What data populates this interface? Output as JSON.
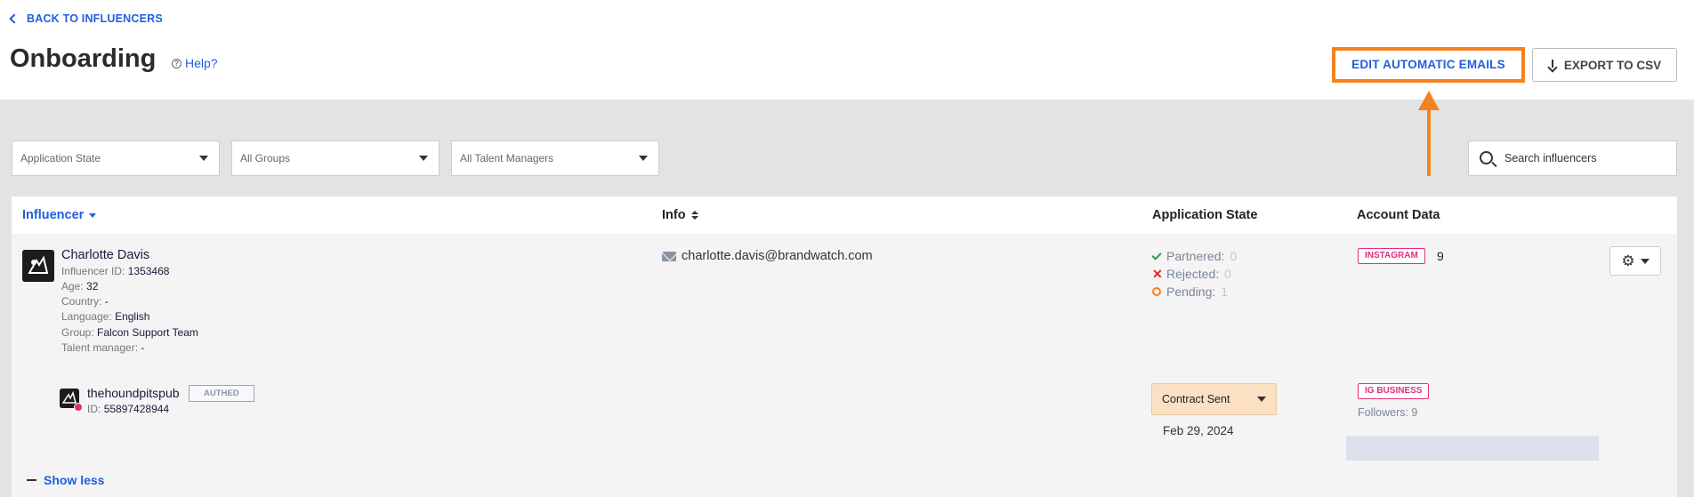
{
  "header": {
    "back_label": "BACK TO INFLUENCERS",
    "title": "Onboarding",
    "help_label": "Help?",
    "edit_emails_label": "EDIT AUTOMATIC EMAILS",
    "export_label": "EXPORT TO CSV",
    "annotation_color": "#f58220"
  },
  "filters": {
    "application_state": "Application State",
    "groups": "All Groups",
    "talent_managers": "All Talent Managers",
    "search_placeholder": "Search influencers"
  },
  "table": {
    "columns": [
      "Influencer",
      "Info",
      "Application State",
      "Account Data"
    ],
    "row": {
      "name": "Charlotte Davis",
      "influencer_id_label": "Influencer ID:",
      "influencer_id": "1353468",
      "age_label": "Age:",
      "age": "32",
      "country_label": "Country:",
      "country": "-",
      "language_label": "Language:",
      "language": "English",
      "group_label": "Group:",
      "group": "Falcon Support Team",
      "talent_manager_label": "Talent manager:",
      "talent_manager": "-",
      "email": "charlotte.davis@brandwatch.com",
      "states": [
        {
          "label": "Partnered:",
          "count": "0",
          "icon": "check-icon"
        },
        {
          "label": "Rejected:",
          "count": "0",
          "icon": "x-icon"
        },
        {
          "label": "Pending:",
          "count": "1",
          "icon": "circle-icon"
        }
      ],
      "account_badge": "INSTAGRAM",
      "account_value": "9",
      "sub_account": {
        "handle": "thehoundpitspub",
        "auth_badge": "AUTHED",
        "id_label": "ID:",
        "id": "55897428944",
        "contract_state": "Contract Sent",
        "date": "Feb 29, 2024",
        "badge": "IG BUSINESS",
        "followers": "Followers: 9"
      }
    },
    "show_less_label": "Show less"
  }
}
